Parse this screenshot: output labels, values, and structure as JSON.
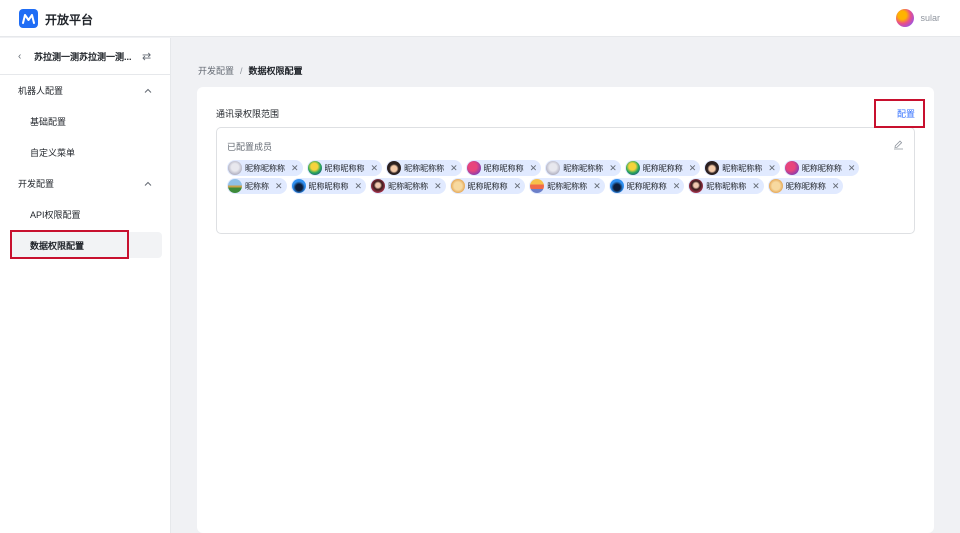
{
  "topbar": {
    "app_title": "开放平台",
    "user_name": "sular"
  },
  "sidebar": {
    "bot_name": "苏拉测一测苏拉测一测...",
    "groups": [
      {
        "label": "机器人配置",
        "items": [
          "基础配置",
          "自定义菜单"
        ]
      },
      {
        "label": "开发配置",
        "items": [
          "API权限配置",
          "数据权限配置"
        ]
      }
    ],
    "active_item": "数据权限配置"
  },
  "breadcrumb": {
    "parent": "开发配置",
    "separator": "/",
    "current": "数据权限配置"
  },
  "card": {
    "section_title": "通讯录权限范围",
    "config_label": "配置",
    "members_title": "已配置成员",
    "members": [
      {
        "name": "昵称昵称称",
        "avatar": "cat-avatar"
      },
      {
        "name": "昵称昵称称",
        "avatar": "parrot-avatar"
      },
      {
        "name": "昵称昵称称",
        "avatar": "girl-avatar"
      },
      {
        "name": "昵称昵称称",
        "avatar": "purple-avatar"
      },
      {
        "name": "昵称昵称称",
        "avatar": "cat-avatar"
      },
      {
        "name": "昵称昵称称",
        "avatar": "parrot-avatar"
      },
      {
        "name": "昵称昵称称",
        "avatar": "girl-avatar"
      },
      {
        "name": "昵称昵称称",
        "avatar": "purple-avatar"
      },
      {
        "name": "昵称称",
        "avatar": "landscape-avatar"
      },
      {
        "name": "昵称昵称称",
        "avatar": "blue-avatar"
      },
      {
        "name": "昵称昵称称",
        "avatar": "dark-avatar"
      },
      {
        "name": "昵称昵称称",
        "avatar": "dog-avatar"
      },
      {
        "name": "昵称昵称称",
        "avatar": "sunset-avatar"
      },
      {
        "name": "昵称昵称称",
        "avatar": "blue-avatar"
      },
      {
        "name": "昵称昵称称",
        "avatar": "dark-avatar"
      },
      {
        "name": "昵称昵称称",
        "avatar": "dog-avatar"
      }
    ]
  },
  "colors": {
    "accent": "#3370ff",
    "highlight": "#c8102e",
    "chip_bg": "#e1eaff"
  }
}
